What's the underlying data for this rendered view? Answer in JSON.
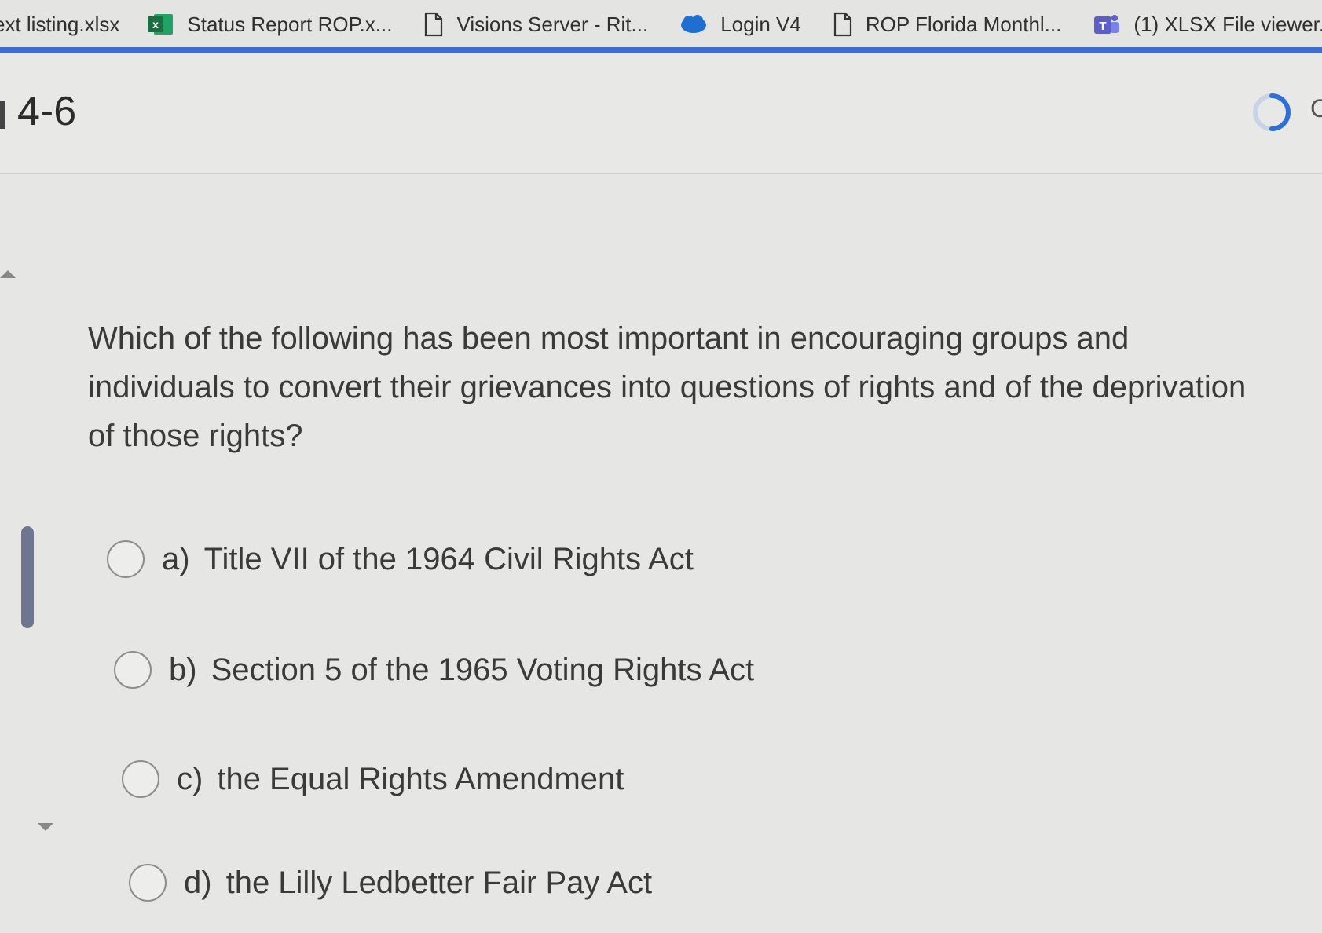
{
  "bookmarks": [
    {
      "label": "ext listing.xlsx",
      "icon": "none"
    },
    {
      "label": "Status Report ROP.x...",
      "icon": "excel-icon"
    },
    {
      "label": "Visions Server - Rit...",
      "icon": "document-icon"
    },
    {
      "label": "Login V4",
      "icon": "cloud-icon"
    },
    {
      "label": "ROP Florida Monthl...",
      "icon": "document-icon"
    },
    {
      "label": "(1) XLSX File viewer...",
      "icon": "teams-icon"
    }
  ],
  "excel_icon_letter": "x",
  "teams_icon_letter": "T",
  "header": {
    "title": "4-6",
    "cut_text": "C"
  },
  "question": {
    "line1": "Which of the following has been most important in encouraging groups and",
    "line2": "individuals to convert their grievances into questions of rights and of the deprivation",
    "line3": "of those rights?"
  },
  "options": [
    {
      "letter": "a)",
      "text": "Title VII of the 1964 Civil Rights Act"
    },
    {
      "letter": "b)",
      "text": "Section 5 of the 1965 Voting Rights Act"
    },
    {
      "letter": "c)",
      "text": "the Equal Rights Amendment"
    },
    {
      "letter": "d)",
      "text": "the Lilly Ledbetter Fair Pay Act"
    }
  ],
  "colors": {
    "accent": "#3f6fcc",
    "scroll_thumb": "#6e7690",
    "cloud": "#1f6fd1",
    "excel": "#1d6f42",
    "teams": "#5b5fc7"
  }
}
